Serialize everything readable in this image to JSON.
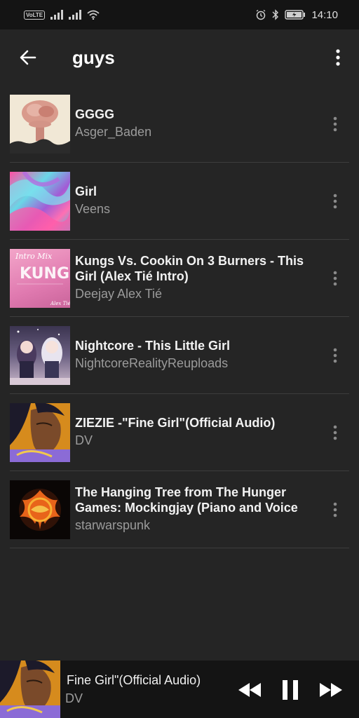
{
  "status_bar": {
    "network_badge": "VoLTE",
    "time": "14:10",
    "icons": [
      "signal-icon",
      "signal-icon",
      "wifi-icon",
      "alarm-icon",
      "bluetooth-icon",
      "battery-icon"
    ]
  },
  "app_bar": {
    "title": "guys",
    "back_icon": "arrow-left-icon",
    "menu_icon": "more-vertical-icon"
  },
  "tracks": [
    {
      "title": "GGGG",
      "artist": "Asger_Baden",
      "thumb": "mushroom-cloud-art"
    },
    {
      "title": "Girl",
      "artist": "Veens",
      "thumb": "colorful-abstract-art"
    },
    {
      "title": "Kungs Vs. Cookin On 3 Burners - This Girl (Alex Tié Intro)",
      "artist": "Deejay Alex Tié",
      "thumb": "kungs-intro-mix-art",
      "thumb_text": "Intro Mix",
      "thumb_logo": "KUNGS",
      "thumb_credit": "Alex Tié"
    },
    {
      "title": "Nightcore - This Little Girl",
      "artist": "NightcoreRealityReuploads",
      "thumb": "anime-girls-art"
    },
    {
      "title": "ZIEZIE -\"Fine Girl\"(Official Audio)",
      "artist": "DV",
      "thumb": "fine-girl-art"
    },
    {
      "title": "The Hanging Tree from The Hunger Games: Mockingjay (Piano and Voice",
      "artist": "starwarspunk",
      "thumb": "mockingjay-fire-art"
    }
  ],
  "now_playing": {
    "title": "Fine Girl\"(Official Audio)",
    "artist": "DV",
    "controls": [
      "rewind-icon",
      "pause-icon",
      "fast-forward-icon"
    ]
  },
  "colors": {
    "background": "#252525",
    "bar": "#141414",
    "divider": "#3d3d3d",
    "secondary_text": "#9b9b9b"
  }
}
